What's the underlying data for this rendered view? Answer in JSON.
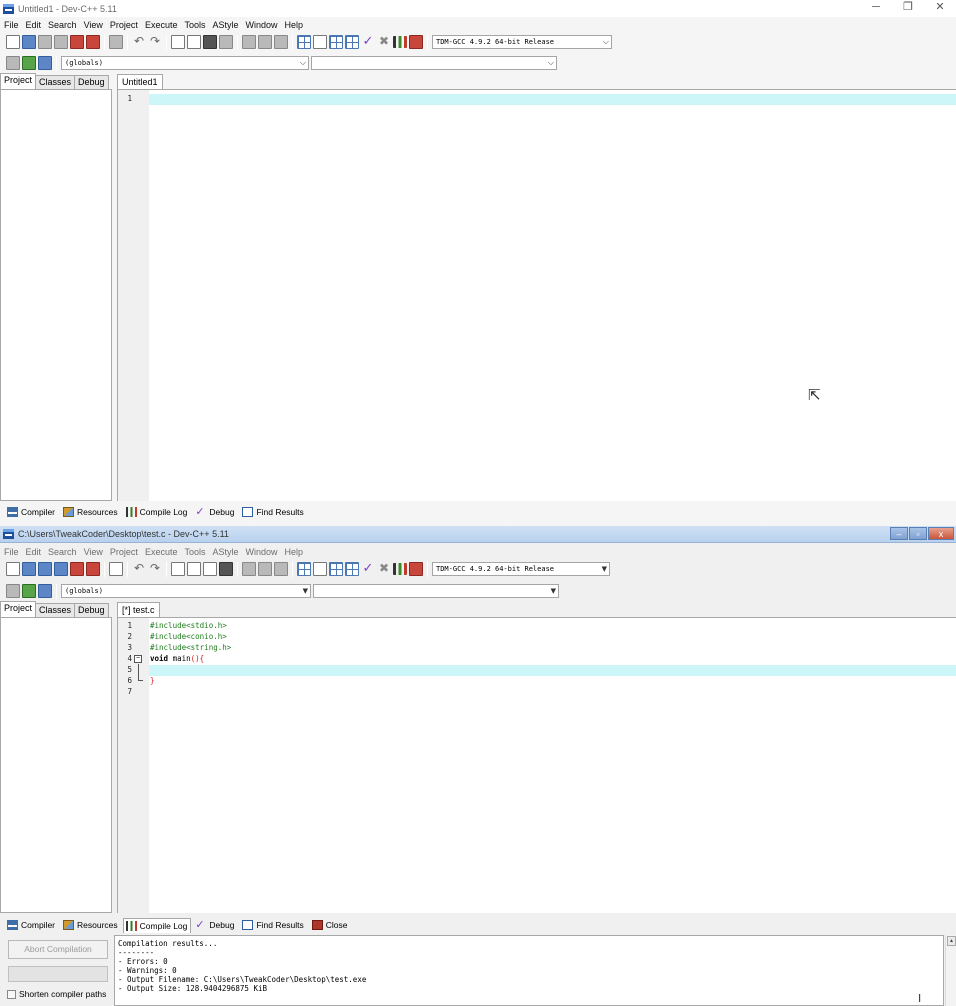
{
  "win1": {
    "title": "Untitled1 - Dev-C++ 5.11",
    "menu": [
      "File",
      "Edit",
      "Search",
      "View",
      "Project",
      "Execute",
      "Tools",
      "AStyle",
      "Window",
      "Help"
    ],
    "compiler_select": "TDM-GCC 4.9.2 64-bit Release",
    "scope_select": "(globals)",
    "panel_tabs": [
      "Project",
      "Classes",
      "Debug"
    ],
    "editor_tab": "Untitled1",
    "line_numbers": [
      "1"
    ],
    "bottom_tabs": [
      "Compiler",
      "Resources",
      "Compile Log",
      "Debug",
      "Find Results"
    ],
    "window_controls": {
      "minimize": "─",
      "restore": "❐",
      "close": "✕"
    }
  },
  "win2": {
    "title": "C:\\Users\\TweakCoder\\Desktop\\test.c - Dev-C++ 5.11",
    "menu": [
      "File",
      "Edit",
      "Search",
      "View",
      "Project",
      "Execute",
      "Tools",
      "AStyle",
      "Window",
      "Help"
    ],
    "compiler_select": "TDM-GCC 4.9.2 64-bit Release",
    "scope_select": "(globals)",
    "panel_tabs": [
      "Project",
      "Classes",
      "Debug"
    ],
    "editor_tab": "[*] test.c",
    "line_numbers": [
      "1",
      "2",
      "3",
      "4",
      "5",
      "6",
      "7"
    ],
    "code": {
      "l1": "#include<stdio.h>",
      "l2": "#include<conio.h>",
      "l3": "#include<string.h>",
      "l4_kw": "void",
      "l4_name": " main",
      "l4_sym": "(){",
      "l6": "}"
    },
    "bottom_tabs": [
      "Compiler",
      "Resources",
      "Compile Log",
      "Debug",
      "Find Results",
      "Close"
    ],
    "abort_button": "Abort Compilation",
    "shorten_paths": "Shorten compiler paths",
    "log_lines": [
      "Compilation results...",
      "--------",
      "- Errors: 0",
      "- Warnings: 0",
      "- Output Filename: C:\\Users\\TweakCoder\\Desktop\\test.exe",
      "- Output Size: 128.9404296875 KiB"
    ],
    "window_controls": {
      "minimize": "–",
      "restore": "▫",
      "close": "x"
    }
  },
  "icons": {
    "toolbar": [
      "new-file-icon",
      "open-icon",
      "save-icon",
      "save-all-icon",
      "close-icon",
      "close-all-icon",
      "print-icon",
      "undo-icon",
      "redo-icon",
      "find-icon",
      "replace-icon",
      "indent-icon",
      "unindent-icon",
      "goto-icon",
      "compile-icon",
      "run-icon",
      "compile-run-icon",
      "rebuild-icon",
      "syntax-check-icon",
      "stop-icon",
      "profile-icon",
      "debug-icon"
    ],
    "cursors": {
      "arrow": "⇱",
      "ibeam": "I"
    }
  }
}
